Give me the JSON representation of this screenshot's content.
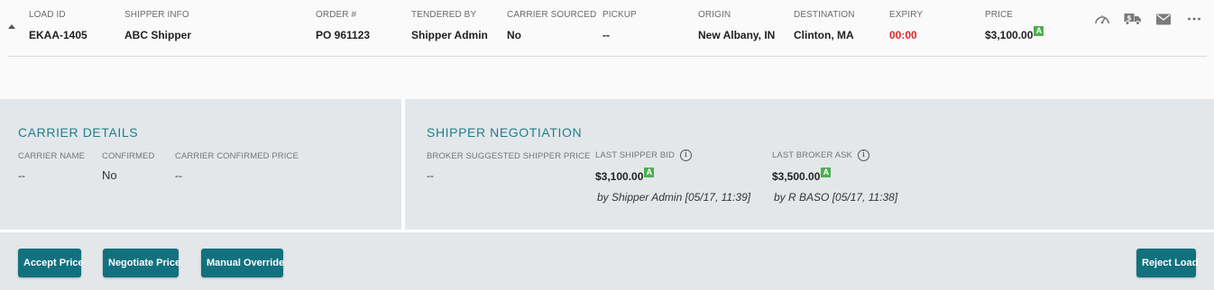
{
  "load": {
    "headers": {
      "load_id": "LOAD ID",
      "shipper_info": "SHIPPER INFO",
      "order": "ORDER #",
      "tendered_by": "TENDERED BY",
      "carrier_sourced": "CARRIER SOURCED",
      "pickup": "PICKUP",
      "origin": "ORIGIN",
      "destination": "DESTINATION",
      "expiry": "EXPIRY",
      "price": "PRICE"
    },
    "values": {
      "load_id": "EKAA-1405",
      "shipper_info": "ABC Shipper",
      "order": "PO 961123",
      "tendered_by": "Shipper Admin",
      "carrier_sourced": "No",
      "pickup": "--",
      "origin": "New Albany, IN",
      "destination": "Clinton, MA",
      "expiry": "00:00",
      "price": "$3,100.00",
      "price_badge": "A"
    },
    "action_icons": [
      "speedometer-icon",
      "truck-dollar-icon",
      "envelope-icon",
      "more-horizontal-icon"
    ]
  },
  "carrier_details": {
    "title": "CARRIER DETAILS",
    "carrier_name_label": "CARRIER NAME",
    "carrier_name_value": "--",
    "confirmed_label": "CONFIRMED",
    "confirmed_value": "No",
    "confirmed_price_label": "CARRIER CONFIRMED PRICE",
    "confirmed_price_value": "--"
  },
  "shipper_negotiation": {
    "title": "SHIPPER NEGOTIATION",
    "suggested_label": "BROKER SUGGESTED SHIPPER PRICE",
    "suggested_value": "--",
    "last_bid_label": "LAST SHIPPER BID",
    "last_bid_value": "$3,100.00",
    "last_bid_badge": "A",
    "last_bid_by": "by Shipper Admin [05/17, 11:39]",
    "last_ask_label": "LAST BROKER ASK",
    "last_ask_value": "$3,500.00",
    "last_ask_badge": "A",
    "last_ask_by": "by R BASO [05/17, 11:38]",
    "info_glyph": "i"
  },
  "footer": {
    "accept_label": "Accept Price",
    "negotiate_label": "Negotiate Price",
    "override_label": "Manual Override",
    "reject_label": "Reject Load"
  },
  "colors": {
    "accent": "#1f7f90",
    "button": "#12717e",
    "expiry": "#e0262b",
    "badge": "#4caf50",
    "panel_bg": "#e4e7e9"
  }
}
